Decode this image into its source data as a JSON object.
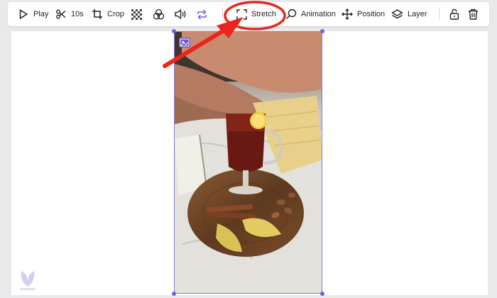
{
  "toolbar": {
    "play_label": "Play",
    "duration_label": "10s",
    "crop_label": "Crop",
    "stretch_label": "Stretch",
    "animation_label": "Animation",
    "position_label": "Position",
    "layer_label": "Layer"
  },
  "colors": {
    "accent": "#7a5fd6",
    "annotation": "#e8271c"
  }
}
